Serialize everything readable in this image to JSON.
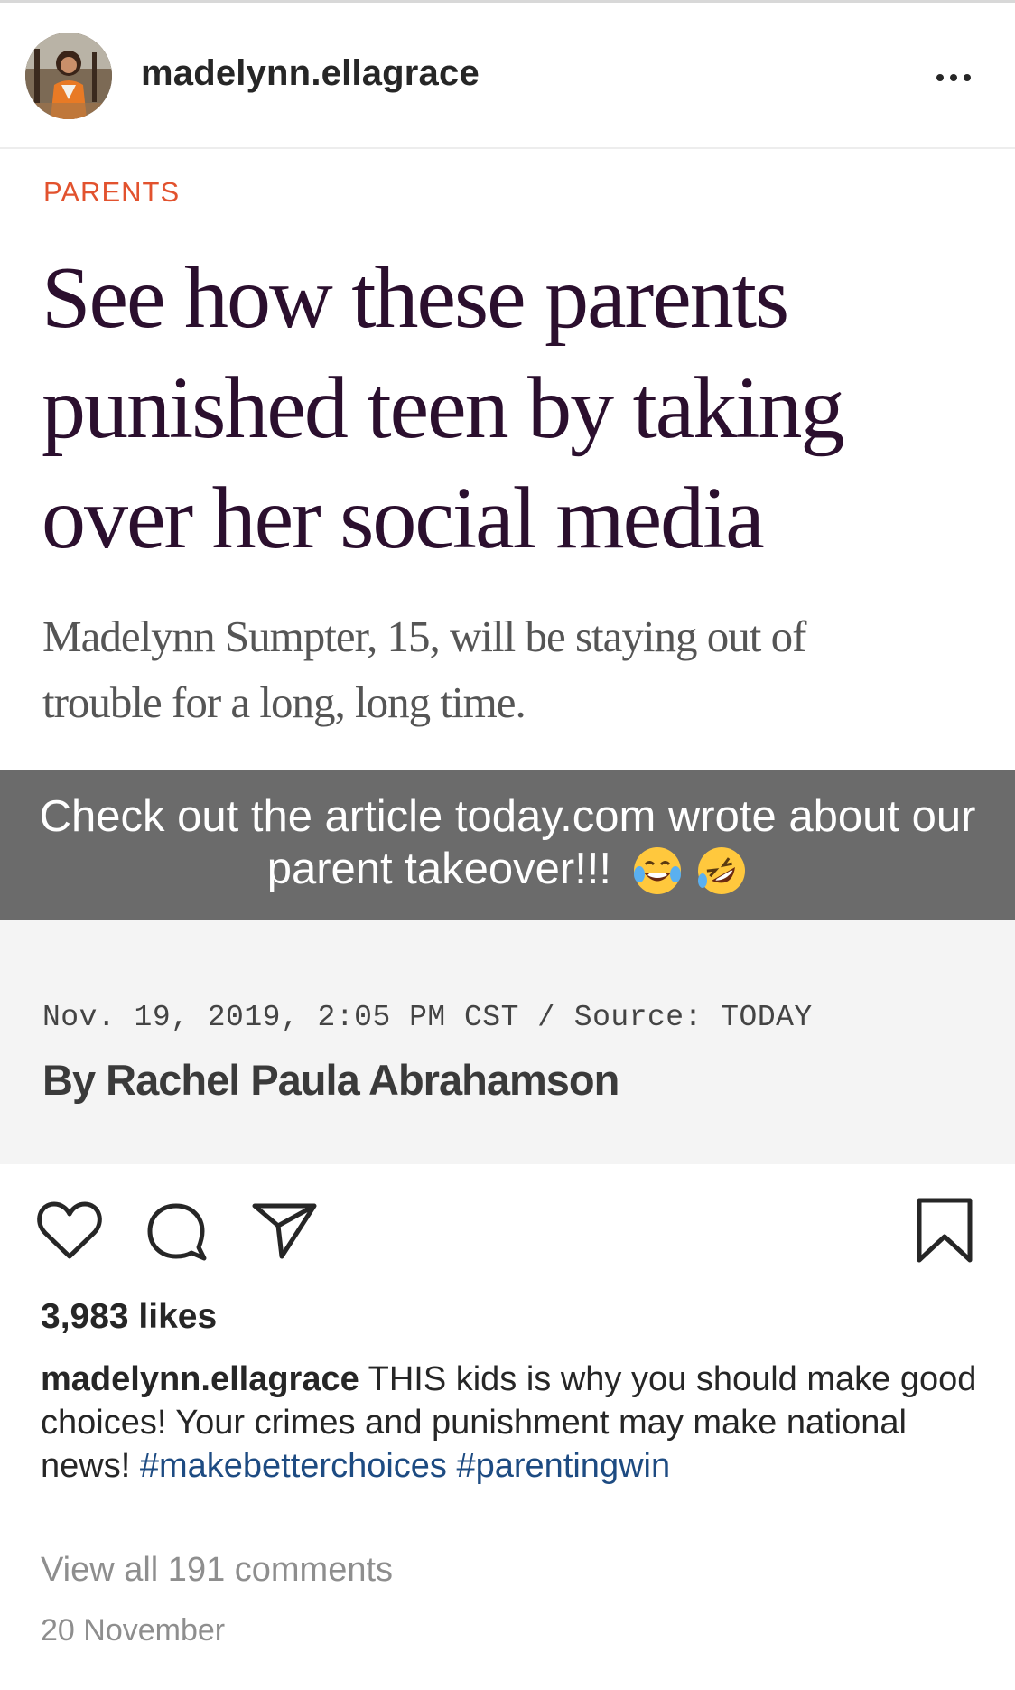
{
  "post": {
    "username": "madelynn.ellagrace",
    "more_icon": "more-horizontal-icon"
  },
  "article": {
    "category": "PARENTS",
    "headline_lines": [
      "See how these parents",
      "punished teen by taking",
      "over her social media"
    ],
    "subhead_lines": [
      "Madelynn Sumpter, 15, will be staying out of",
      "trouble for a long, long time."
    ],
    "banner_line1": "Check out the article today.com wrote about our",
    "banner_line2": "parent takeover!!!",
    "dateline": "Nov. 19, 2019, 2:05 PM CST / Source: TODAY",
    "byline": "By Rachel Paula Abrahamson",
    "colors": {
      "category": "#e2522e",
      "headline": "#2b0f2e",
      "banner": "#6b6b6b"
    }
  },
  "actions": {
    "like_icon": "heart-icon",
    "comment_icon": "comment-icon",
    "share_icon": "send-icon",
    "save_icon": "bookmark-icon"
  },
  "likes": "3,983 likes",
  "caption": {
    "author": "madelynn.ellagrace",
    "text": "THIS kids is why you should make good choices!  Your crimes and punishment may make national news!",
    "hashtags": [
      "#makebetterchoices",
      "#parentingwin"
    ]
  },
  "view_comments": "View all 191 comments",
  "date": "20 November"
}
